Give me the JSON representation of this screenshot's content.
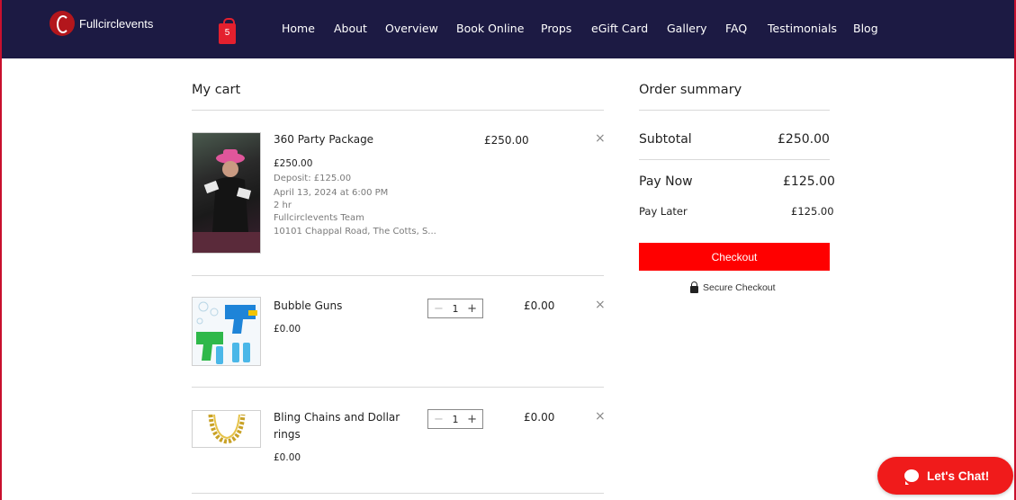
{
  "header": {
    "logo_text": "Fullcirclevents",
    "cart_count": "5",
    "nav": [
      "Home",
      "About",
      "Overview",
      "Book Online",
      "Props",
      "eGift Card",
      "Gallery",
      "FAQ",
      "Testimonials",
      "Blog"
    ]
  },
  "cart": {
    "title": "My cart",
    "items": [
      {
        "name": "360 Party Package",
        "price": "£250.00",
        "deposit": "Deposit: £125.00",
        "date": "April 13, 2024 at 6:00 PM",
        "duration": "2 hr",
        "staff": "Fullcirclevents Team",
        "location": "10101 Chappal Road, The Cotts, S...",
        "total": "£250.00"
      },
      {
        "name": "Bubble Guns",
        "price": "£0.00",
        "quantity": "1",
        "total": "£0.00"
      },
      {
        "name": "Bling Chains and Dollar rings",
        "price": "£0.00",
        "quantity": "1",
        "total": "£0.00"
      }
    ],
    "remove_symbol": "×",
    "minus_symbol": "−",
    "plus_symbol": "+"
  },
  "summary": {
    "title": "Order summary",
    "subtotal_label": "Subtotal",
    "subtotal_value": "£250.00",
    "pay_now_label": "Pay Now",
    "pay_now_value": "£125.00",
    "pay_later_label": "Pay Later",
    "pay_later_value": "£125.00",
    "checkout_label": "Checkout",
    "secure_label": "Secure Checkout"
  },
  "chat": {
    "label": "Let's Chat!"
  },
  "icons": {
    "logo": "circle-logo-icon",
    "cart": "shopping-bag-icon",
    "remove": "close-icon",
    "secure": "lock-icon",
    "chat": "chat-bubble-icon"
  },
  "colors": {
    "header_bg": "#1c1a43",
    "accent": "#ff0000",
    "frame": "#c8102e"
  }
}
